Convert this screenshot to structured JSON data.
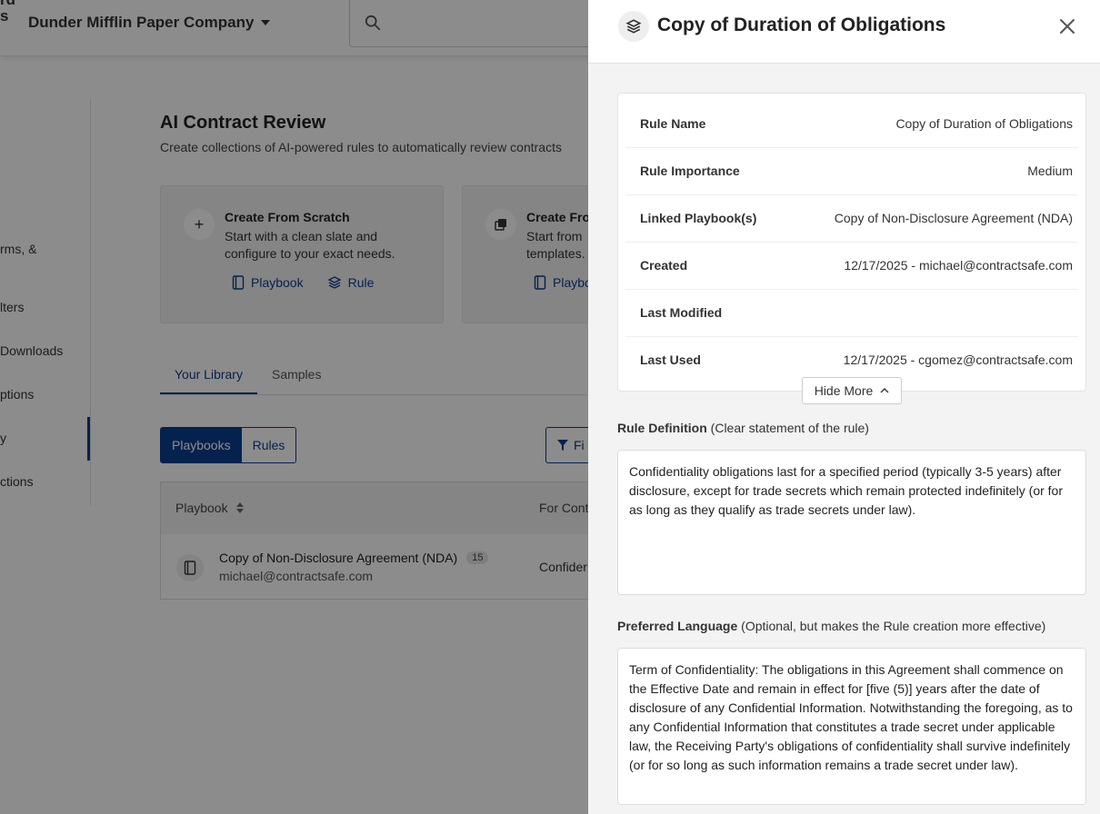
{
  "topbar": {
    "brand_line1": "rd",
    "brand_line2": "s",
    "company": "Dunder Mifflin Paper Company"
  },
  "sidebar": {
    "items": [
      "rms, &",
      "lters",
      "Downloads",
      "ptions",
      "y",
      "ctions"
    ]
  },
  "content": {
    "title": "AI Contract Review",
    "subtitle": "Create collections of AI-powered rules to automatically review contracts"
  },
  "cards": [
    {
      "title": "Create From Scratch",
      "desc": "Start with a clean slate and configure to your exact needs.",
      "link1": "Playbook",
      "link2": "Rule"
    },
    {
      "title": "Create Fro",
      "desc": "Start from templates.",
      "link1": "Playbo"
    }
  ],
  "tabs": [
    "Your Library",
    "Samples"
  ],
  "segmented": [
    "Playbooks",
    "Rules"
  ],
  "filter_label": "Fi",
  "table": {
    "col1": "Playbook",
    "col2": "For Cont",
    "row": {
      "title": "Copy of Non-Disclosure Agreement (NDA)",
      "count": "15",
      "email": "michael@contractsafe.com",
      "for": "Confider"
    }
  },
  "drawer": {
    "title": "Copy of Duration of Obligations",
    "details": [
      {
        "key": "Rule Name",
        "value": "Copy of Duration of Obligations"
      },
      {
        "key": "Rule Importance",
        "value": "Medium"
      },
      {
        "key": "Linked Playbook(s)",
        "value": "Copy of Non-Disclosure Agreement (NDA)"
      },
      {
        "key": "Created",
        "value": "12/17/2025 - michael@contractsafe.com"
      },
      {
        "key": "Last Modified",
        "value": ""
      },
      {
        "key": "Last Used",
        "value": "12/17/2025 - cgomez@contractsafe.com"
      }
    ],
    "hide_more": "Hide More",
    "rule_definition_label": "Rule Definition",
    "rule_definition_hint": " (Clear statement of the rule)",
    "rule_definition_text": "Confidentiality obligations last for a specified period (typically 3-5 years) after disclosure, except for trade secrets which remain protected indefinitely (or for as long as they qualify as trade secrets under law).",
    "preferred_label": "Preferred Language",
    "preferred_hint": " (Optional, but makes the Rule creation more effective)",
    "preferred_text": "Term of Confidentiality: The obligations in this Agreement shall commence on the Effective Date and remain in effect for [five (5)] years after the date of disclosure of any Confidential Information. Notwithstanding the foregoing, as to any Confidential Information that constitutes a trade secret under applicable law, the Receiving Party's obligations of confidentiality shall survive indefinitely (or for so long as such information remains a trade secret under law)."
  }
}
